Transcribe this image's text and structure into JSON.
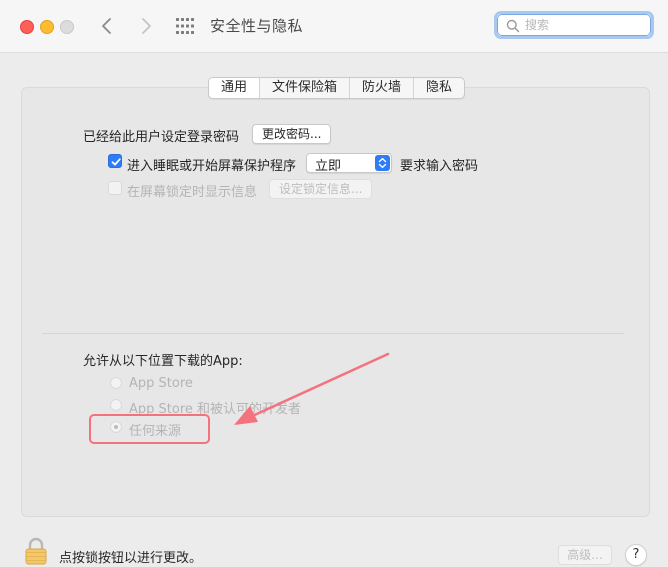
{
  "window": {
    "title": "安全性与隐私"
  },
  "search": {
    "placeholder": "搜索",
    "value": ""
  },
  "tabs": [
    {
      "label": "通用",
      "selected": true
    },
    {
      "label": "文件保险箱",
      "selected": false
    },
    {
      "label": "防火墙",
      "selected": false
    },
    {
      "label": "隐私",
      "selected": false
    }
  ],
  "general": {
    "password_label": "已经给此用户设定登录密码",
    "change_password_button": "更改密码...",
    "require_password": {
      "checked": true,
      "label": "进入睡眠或开始屏幕保护程序",
      "delay_value": "立即",
      "suffix": "要求输入密码"
    },
    "lock_message": {
      "checked": false,
      "disabled": true,
      "label": "在屏幕锁定时显示信息",
      "button": "设定锁定信息..."
    }
  },
  "downloads": {
    "heading": "允许从以下位置下载的App:",
    "options": [
      {
        "label": "App Store",
        "selected": false
      },
      {
        "label": "App Store 和被认可的开发者",
        "selected": false
      },
      {
        "label": "任何来源",
        "selected": true
      }
    ]
  },
  "footer": {
    "lock_text": "点按锁按钮以进行更改。",
    "advanced_button": "高级...",
    "help_button": "?"
  },
  "colors": {
    "accent": "#2f7cf6",
    "highlight": "#f4727e",
    "close": "#fe5f57",
    "minimize": "#febc2e"
  },
  "icons": {
    "lock": "lock-icon",
    "search": "search-icon",
    "grid": "grid-icon",
    "back": "chevron-left-icon",
    "forward": "chevron-right-icon"
  }
}
